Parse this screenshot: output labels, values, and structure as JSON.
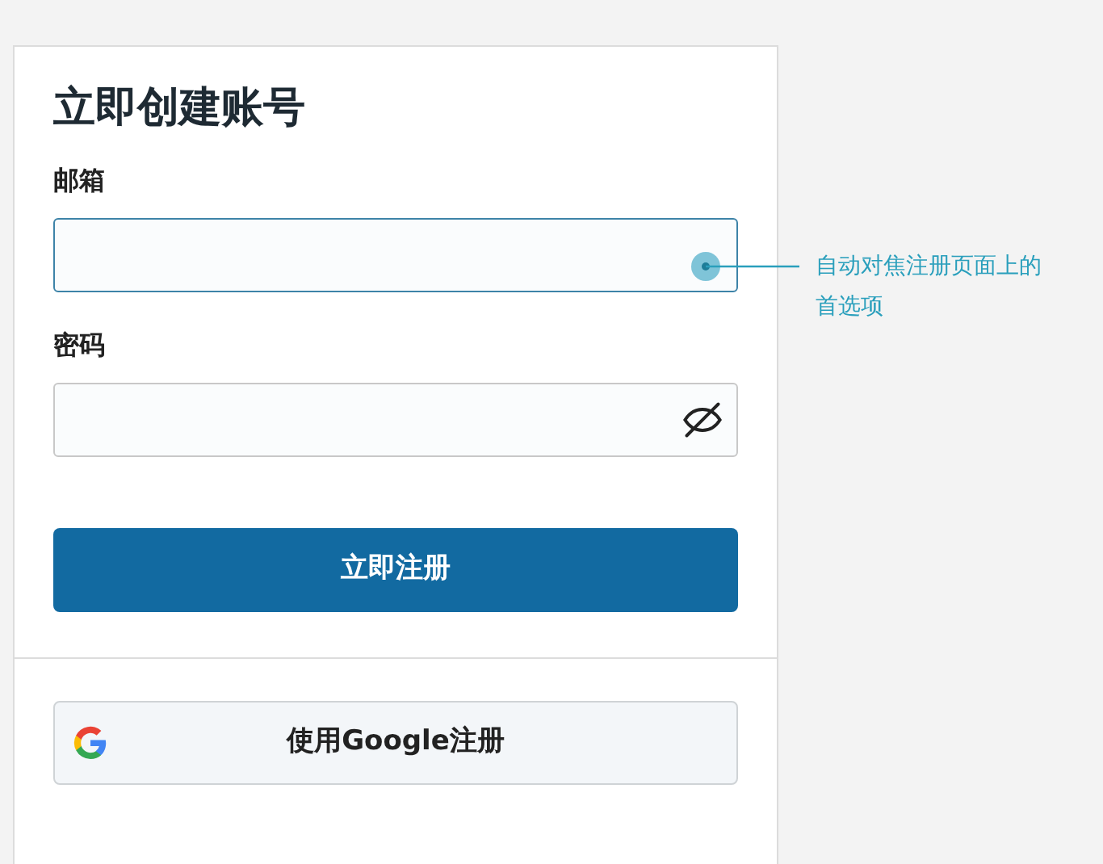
{
  "title": "立即创建账号",
  "fields": [
    {
      "label": "邮箱",
      "focused": true,
      "kind": "text"
    },
    {
      "label": "密码",
      "focused": false,
      "kind": "password"
    }
  ],
  "submit_button": "立即注册",
  "google_button": "使用Google注册",
  "callout": "自动对焦注册页面上的首选项"
}
